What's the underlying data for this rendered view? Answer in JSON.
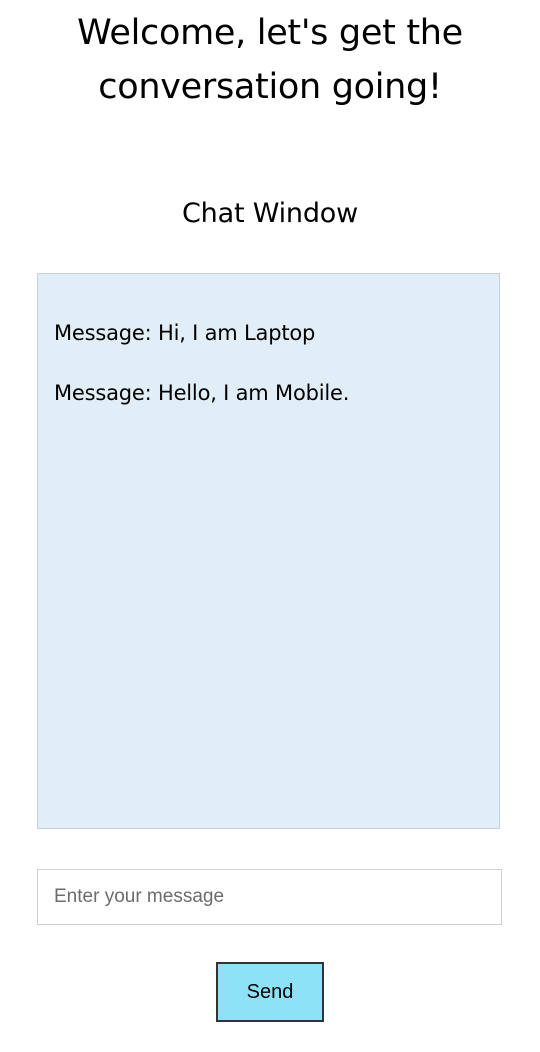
{
  "header": {
    "title": "Welcome, let's get the conversation going!"
  },
  "chat": {
    "title": "Chat Window",
    "messages": [
      "Message: Hi, I am Laptop",
      "Message: Hello, I am Mobile."
    ]
  },
  "composer": {
    "input_value": "",
    "input_placeholder": "Enter your message",
    "send_label": "Send"
  }
}
